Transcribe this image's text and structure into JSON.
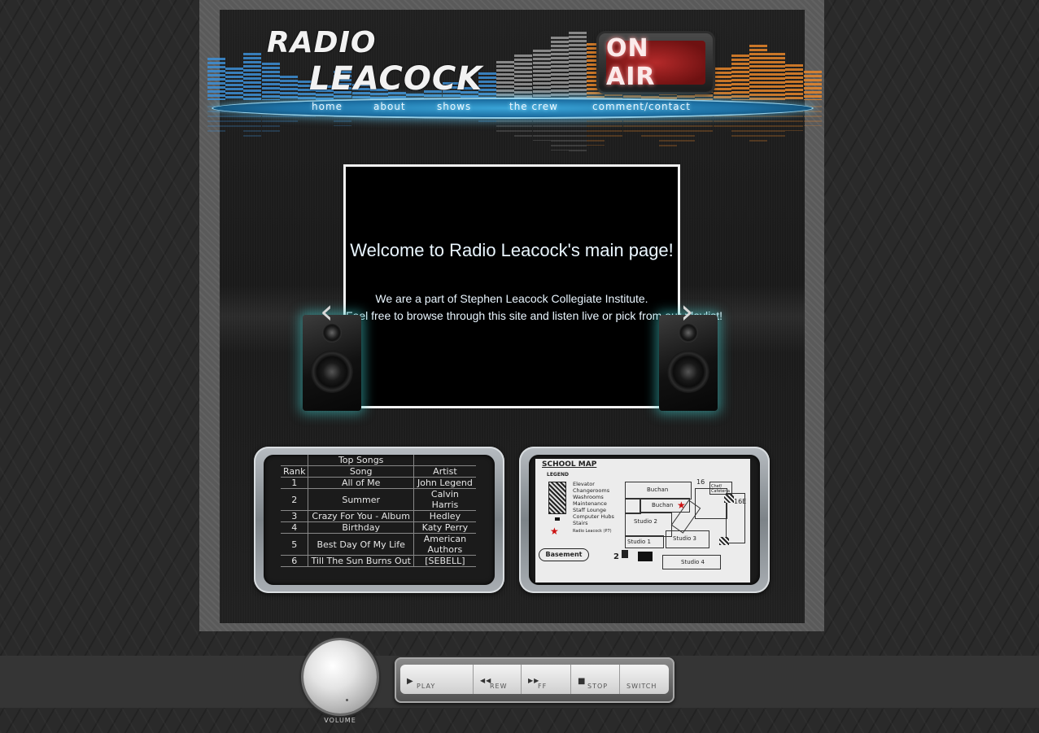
{
  "site": {
    "logo_line1": "RADIO",
    "logo_line2": "LEACOCK",
    "on_air": "ON AIR"
  },
  "nav": [
    {
      "label": "home"
    },
    {
      "label": "about"
    },
    {
      "label": "shows"
    },
    {
      "label": "the crew"
    },
    {
      "label": "comment/contact"
    }
  ],
  "slider": {
    "title": "Welcome to Radio Leacock's main page!",
    "line1": "We are a part of Stephen Leacock Collegiate Institute.",
    "line2": "Feel free to browse through this site and listen live or pick from our playlist!",
    "prev_icon": "chevron-left-icon",
    "next_icon": "chevron-right-icon"
  },
  "top_songs": {
    "caption": "Top Songs",
    "headers": [
      "Rank",
      "Song",
      "Artist"
    ],
    "rows": [
      [
        "1",
        "All of Me",
        "John Legend"
      ],
      [
        "2",
        "Summer",
        "Calvin Harris"
      ],
      [
        "3",
        "Crazy For You - Album",
        "Hedley"
      ],
      [
        "4",
        "Birthday",
        "Katy Perry"
      ],
      [
        "5",
        "Best Day Of My Life",
        "American Authors"
      ],
      [
        "6",
        "Till The Sun Burns Out",
        "[SEBELL]"
      ]
    ]
  },
  "map": {
    "title": "SCHOOL MAP",
    "legend_title": "LEGEND",
    "legend": [
      "Elevator",
      "Changerooms",
      "Washrooms",
      "Maintenance",
      "Staff Lounge",
      "Computer Hubs",
      "Stairs",
      "Radio Leacock (P7)"
    ],
    "floor": "Basement",
    "rooms": [
      "Buchan",
      "Buchan",
      "Studio 2",
      "Studio 1",
      "Studio 3",
      "Studio 4",
      "Chef/ Cafeteria",
      "16",
      "16E",
      "2"
    ]
  },
  "player": {
    "volume_label": "VOLUME",
    "buttons": [
      {
        "label": "PLAY",
        "icon": "play-icon",
        "glyph": "▶"
      },
      {
        "label": "REW",
        "icon": "rewind-icon",
        "glyph": "◀◀"
      },
      {
        "label": "FF",
        "icon": "fast-forward-icon",
        "glyph": "▶▶"
      },
      {
        "label": "STOP",
        "icon": "stop-icon",
        "glyph": "■"
      },
      {
        "label": "SWITCH",
        "icon": "switch-icon",
        "glyph": ""
      }
    ]
  },
  "colors": {
    "nav_glow": "#66d2ff",
    "on_air_red": "#b42a2a",
    "eq_blue": "#3d8fd6",
    "eq_orange": "#e8862a",
    "speaker_glow": "#40c8c8"
  }
}
